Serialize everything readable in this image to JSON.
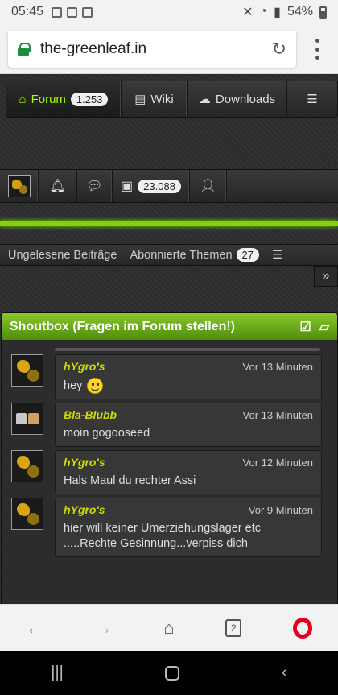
{
  "status": {
    "time": "05:45",
    "battery": "54%"
  },
  "browser": {
    "url": "the-greenleaf.in",
    "tab_count": "2"
  },
  "nav": {
    "forum": {
      "label": "Forum",
      "count": "1.253"
    },
    "wiki": "Wiki",
    "downloads": "Downloads"
  },
  "userbar": {
    "points": "23.088"
  },
  "subnav": {
    "unread": "Ungelesene Beiträge",
    "subscribed": "Abonnierte Themen",
    "subscribed_count": "27"
  },
  "shoutbox": {
    "title": "Shoutbox (Fragen im Forum stellen!)",
    "messages": [
      {
        "author": "hYgro's",
        "time": "Vor 13 Minuten",
        "text": "hey",
        "smiley": true
      },
      {
        "author": "Bla-Blubb",
        "time": "Vor 13 Minuten",
        "text": "moin gogooseed"
      },
      {
        "author": "hYgro's",
        "time": "Vor 12 Minuten",
        "text": "Hals Maul du rechter Assi"
      },
      {
        "author": "hYgro's",
        "time": "Vor 9 Minuten",
        "text": "hier will keiner Umerziehungslager etc .....Rechte Gesinnung...verpiss dich"
      }
    ]
  },
  "colors": {
    "accent": "#9dff00",
    "shoutbox_header": "#6aab1a",
    "author": "#cfdc00",
    "opera": "#e4001b"
  }
}
